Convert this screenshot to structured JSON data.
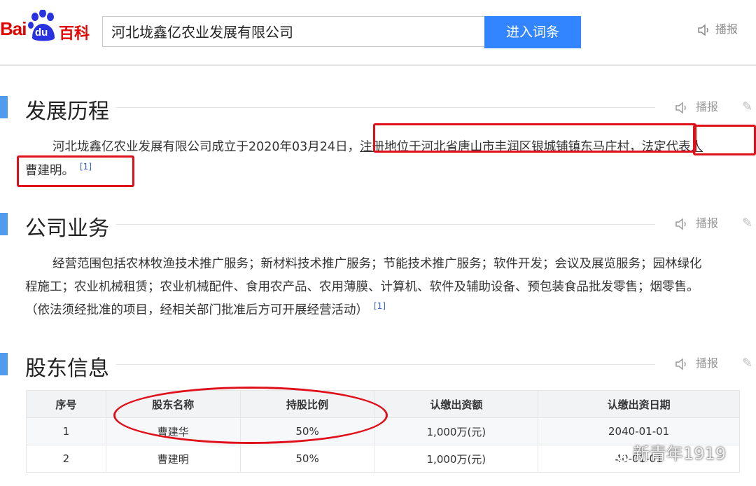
{
  "header": {
    "logo_bai": "Bai",
    "logo_du": "du",
    "logo_baike": "百科",
    "search_value": "河北垅鑫亿农业发展有限公司",
    "search_button": "进入词条",
    "voice_label": "播报"
  },
  "sections": [
    {
      "title": "发展历程",
      "voice": "播报",
      "line1_a": "河北垅鑫亿农业发展有限公司成立于2020年03月24日，",
      "line1_b": "注册地位于河北省唐山市丰润区银城铺镇东马庄村，",
      "line1_c": "法定代表人",
      "line2": "曹建明。",
      "ref": "[1]"
    },
    {
      "title": "公司业务",
      "voice": "播报",
      "line1": "经营范围包括农林牧渔技术推广服务；新材料技术推广服务；节能技术推广服务；软件开发；会议及展览服务；园林绿化",
      "line2": "程施工；农业机械租赁；农业机械配件、食用农产品、农用薄膜、计算机、软件及辅助设备、预包装食品批发零售；烟零售。",
      "line3": "（依法须经批准的项目，经相关部门批准后方可开展经营活动）",
      "ref": "[1]"
    },
    {
      "title": "股东信息",
      "voice": "播报"
    }
  ],
  "table": {
    "headers": [
      "序号",
      "股东名称",
      "持股比例",
      "认缴出资额",
      "认缴出资日期"
    ],
    "rows": [
      [
        "1",
        "曹建华",
        "50%",
        "1,000万(元)",
        "2040-01-01"
      ],
      [
        "2",
        "曹建明",
        "50%",
        "1,000万(元)",
        "40-01-01"
      ]
    ]
  },
  "watermark": "新青年1919",
  "colors": {
    "accent_blue": "#3385ff",
    "section_bar": "#4f9cee",
    "annotation_red": "#e0101a",
    "brand_red": "#e10601"
  }
}
